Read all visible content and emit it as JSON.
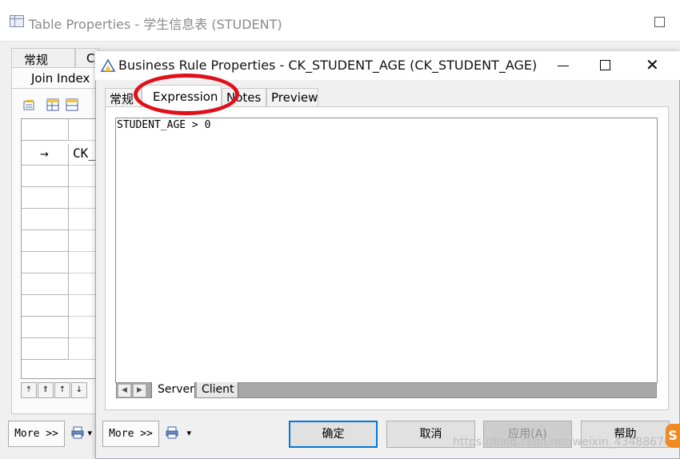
{
  "bg_window": {
    "title": "Table Properties - 学生信息表 (STUDENT)",
    "tabs_row1": [
      "常规",
      "C"
    ],
    "tab_active": "Join Index",
    "grid_cell": "CK_",
    "row_marker": "→",
    "more_label": "More >>"
  },
  "dialog": {
    "title": "Business Rule Properties - CK_STUDENT_AGE (CK_STUDENT_AGE)",
    "close_glyph": "✕",
    "tabs": [
      "常规",
      "Expression",
      "Notes",
      "Preview"
    ],
    "active_tab": "Expression",
    "expression": "STUDENT_AGE > 0",
    "subtabs": [
      "Server",
      "Client"
    ],
    "active_subtab": "Server",
    "buttons": {
      "ok": "确定",
      "cancel": "取消",
      "apply": "应用(A)",
      "help": "帮助"
    },
    "apply_disabled": true,
    "more_label": "More >>",
    "menu_arrow": "▾"
  },
  "annotation": {
    "color": "#e0101a"
  },
  "watermark": "https://blog.csdn.net/weixin_43488670",
  "colors": {
    "accent": "#0078d7",
    "window_bg": "#f0f0f0"
  }
}
